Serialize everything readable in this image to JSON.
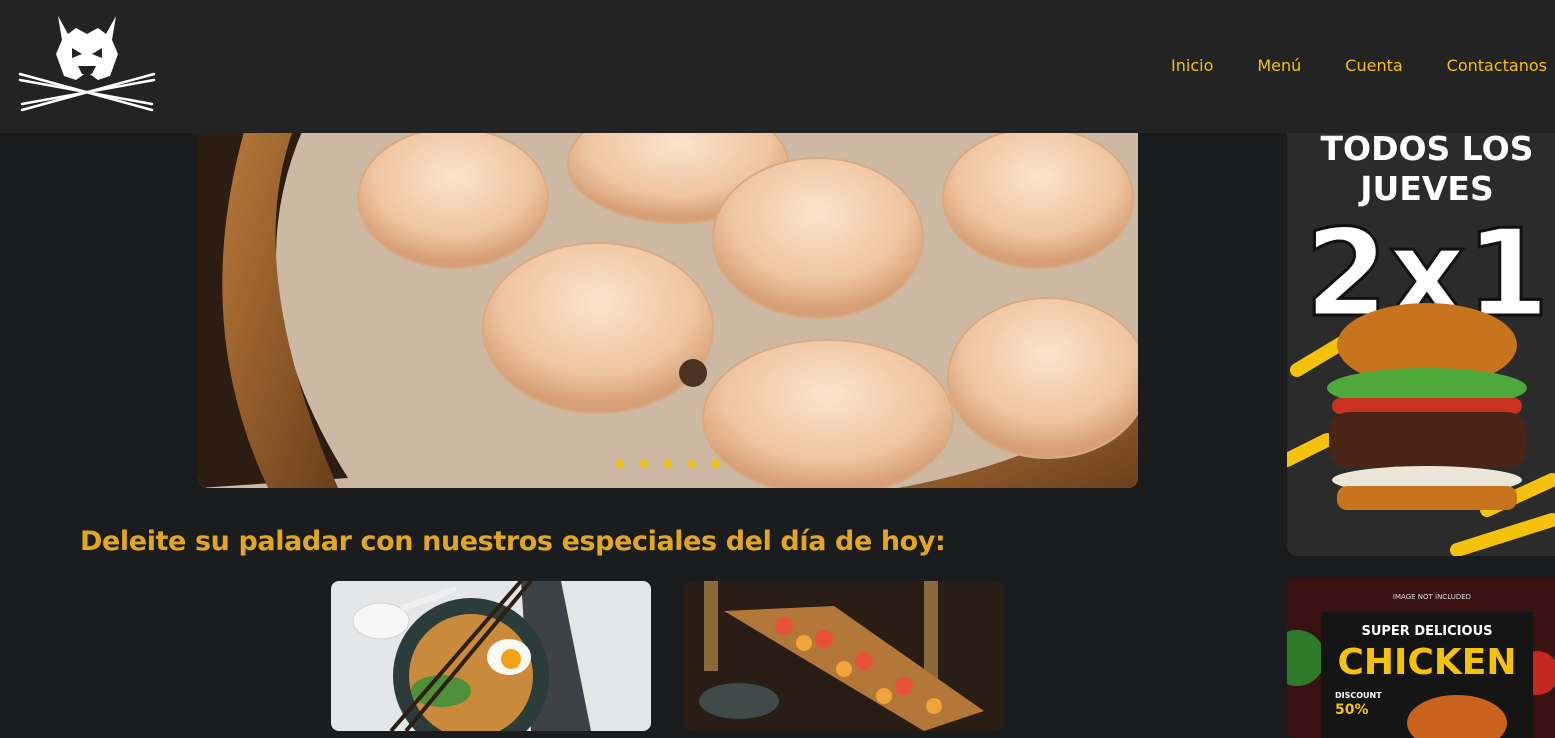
{
  "navbar": {
    "logo_icon": "samurai-helmet-crossed-swords",
    "links": [
      "Inicio",
      "Menú",
      "Cuenta",
      "Contactanos"
    ]
  },
  "carousel": {
    "slide_count": 5,
    "image": "steamed-dumplings-in-bamboo-basket"
  },
  "promos": {
    "thursday": {
      "line1": "TODOS LOS",
      "line2": "JUEVES",
      "deal": "2x1",
      "image": "burger"
    },
    "chicken": {
      "note": "IMAGE NOT INCLUDED",
      "top": "SUPER DELICIOUS",
      "main": "CHICKEN",
      "discount_label": "DISCOUNT",
      "discount_value": "50%"
    }
  },
  "specials": {
    "title": "Deleite su paladar con nuestros especiales del día de hoy:",
    "cards": [
      "ramen-bowl",
      "sushi-boat"
    ]
  },
  "colors": {
    "accent": "#f4c20d",
    "title": "#e1a722",
    "navbar": "#232323",
    "background": "#1b1c1e"
  }
}
